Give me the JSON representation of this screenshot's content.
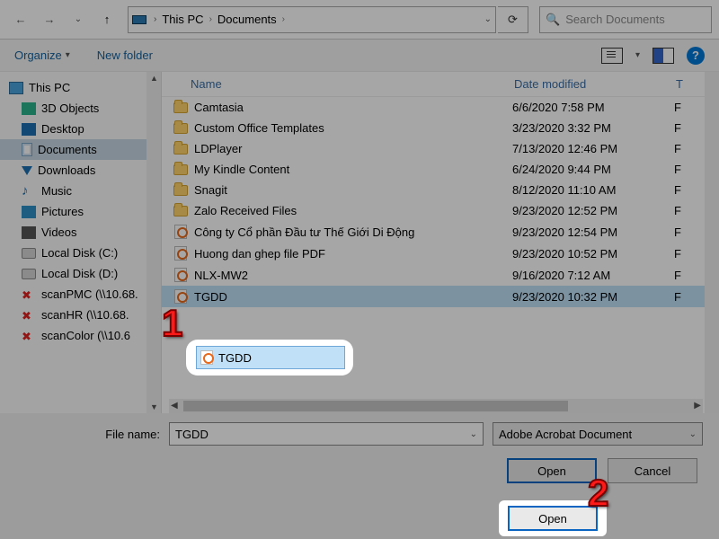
{
  "nav": {
    "crumb_root": "This PC",
    "crumb_current": "Documents",
    "dropdown_glyph": "⌄",
    "refresh_glyph": "⟳",
    "search_placeholder": "Search Documents",
    "search_icon": "🔍"
  },
  "toolbar": {
    "organize": "Organize",
    "organize_chev": "▾",
    "new_folder": "New folder",
    "help_glyph": "?"
  },
  "tree": {
    "root": "This PC",
    "items": [
      {
        "label": "3D Objects"
      },
      {
        "label": "Desktop"
      },
      {
        "label": "Documents"
      },
      {
        "label": "Downloads"
      },
      {
        "label": "Music"
      },
      {
        "label": "Pictures"
      },
      {
        "label": "Videos"
      },
      {
        "label": "Local Disk (C:)"
      },
      {
        "label": "Local Disk (D:)"
      },
      {
        "label": "scanPMC (\\\\10.68."
      },
      {
        "label": "scanHR (\\\\10.68."
      },
      {
        "label": "scanColor (\\\\10.6"
      }
    ]
  },
  "columns": {
    "name": "Name",
    "date": "Date modified",
    "type": "T"
  },
  "rows": [
    {
      "kind": "folder",
      "name": "Camtasia",
      "date": "6/6/2020 7:58 PM",
      "type": "F"
    },
    {
      "kind": "folder",
      "name": "Custom Office Templates",
      "date": "3/23/2020 3:32 PM",
      "type": "F"
    },
    {
      "kind": "folder",
      "name": "LDPlayer",
      "date": "7/13/2020 12:46 PM",
      "type": "F"
    },
    {
      "kind": "folder",
      "name": "My Kindle Content",
      "date": "6/24/2020 9:44 PM",
      "type": "F"
    },
    {
      "kind": "folder",
      "name": "Snagit",
      "date": "8/12/2020 11:10 AM",
      "type": "F"
    },
    {
      "kind": "folder",
      "name": "Zalo Received Files",
      "date": "9/23/2020 12:52 PM",
      "type": "F"
    },
    {
      "kind": "pdf",
      "name": "Công ty Cổ phần Đầu tư Thế Giới Di Động",
      "date": "9/23/2020 12:54 PM",
      "type": "F"
    },
    {
      "kind": "pdf",
      "name": "Huong dan ghep file PDF",
      "date": "9/23/2020 10:52 PM",
      "type": "F"
    },
    {
      "kind": "pdf",
      "name": "NLX-MW2",
      "date": "9/16/2020 7:12 AM",
      "type": "F"
    },
    {
      "kind": "pdf",
      "name": "TGDD",
      "date": "9/23/2020 10:32 PM",
      "type": "F",
      "selected": true
    }
  ],
  "callout1": {
    "label": "TGDD"
  },
  "footer": {
    "filename_label": "File name:",
    "filename_value": "TGDD",
    "filter_label": "Adobe Acrobat Document",
    "open": "Open",
    "cancel": "Cancel",
    "chev": "⌄"
  },
  "annotations": {
    "one": "1",
    "two": "2"
  }
}
